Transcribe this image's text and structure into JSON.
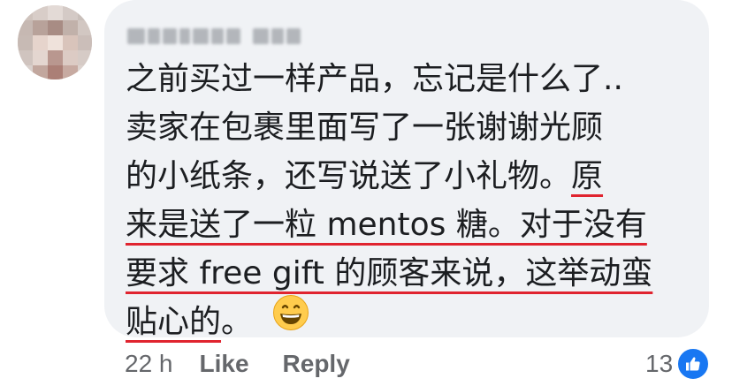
{
  "comment": {
    "author": "Lorraine Lim",
    "lines": [
      "之前买过一样产品，忘记是什么了..",
      "卖家在包裹里面写了一张谢谢光顾",
      "的小纸条，还写说送了小礼物。"
    ],
    "line3_underlined": "原",
    "line4": "来是送了一粒 mentos 糖。对于没有",
    "line5": "要求 free gift 的顾客来说，这举动蛮",
    "line6": "贴心的",
    "line6_end": "。",
    "emoji": "grinning-face-icon"
  },
  "footer": {
    "time": "22 h",
    "like_label": "Like",
    "reply_label": "Reply",
    "reaction_count": "13",
    "reaction_icon": "thumbs-up-icon"
  },
  "colors": {
    "bubble": "#f0f2f5",
    "text": "#1c1e21",
    "muted": "#65676b",
    "underline": "#e0242f",
    "like_blue": "#1877f2"
  }
}
